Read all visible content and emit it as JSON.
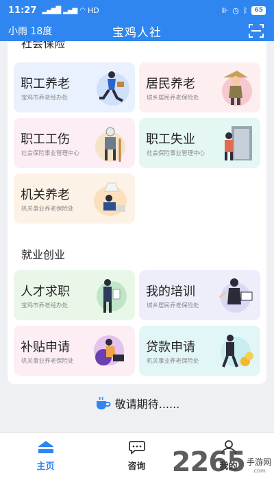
{
  "status": {
    "time": "11:27",
    "network": "HD",
    "battery": "65"
  },
  "header": {
    "weather": "小雨 18度",
    "title": "宝鸡人社"
  },
  "sections": [
    {
      "title": "社会保险",
      "tiles": [
        {
          "name": "职工养老",
          "sub": "宝鸡市养老经办处"
        },
        {
          "name": "居民养老",
          "sub": "城乡居民养老保险处"
        },
        {
          "name": "职工工伤",
          "sub": "社会保险事业管理中心"
        },
        {
          "name": "职工失业",
          "sub": "社会保险事业管理中心"
        },
        {
          "name": "机关养老",
          "sub": "机关事业养老保险处"
        }
      ]
    },
    {
      "title": "就业创业",
      "tiles": [
        {
          "name": "人才求职",
          "sub": "宝鸡市养老经办处"
        },
        {
          "name": "我的培训",
          "sub": "城乡居民养老保险处"
        },
        {
          "name": "补贴申请",
          "sub": "机关事业养老保险处"
        },
        {
          "name": "贷款申请",
          "sub": "机关事业养老保险处"
        }
      ]
    }
  ],
  "coming_soon": "敬请期待......",
  "tabs": [
    {
      "label": "主页",
      "active": true
    },
    {
      "label": "咨询",
      "active": false
    },
    {
      "label": "我的",
      "active": false
    }
  ],
  "watermark": {
    "num": "2265",
    "cn": "手游网",
    "en": ".com"
  },
  "colors": {
    "primary": "#2f86f0"
  }
}
